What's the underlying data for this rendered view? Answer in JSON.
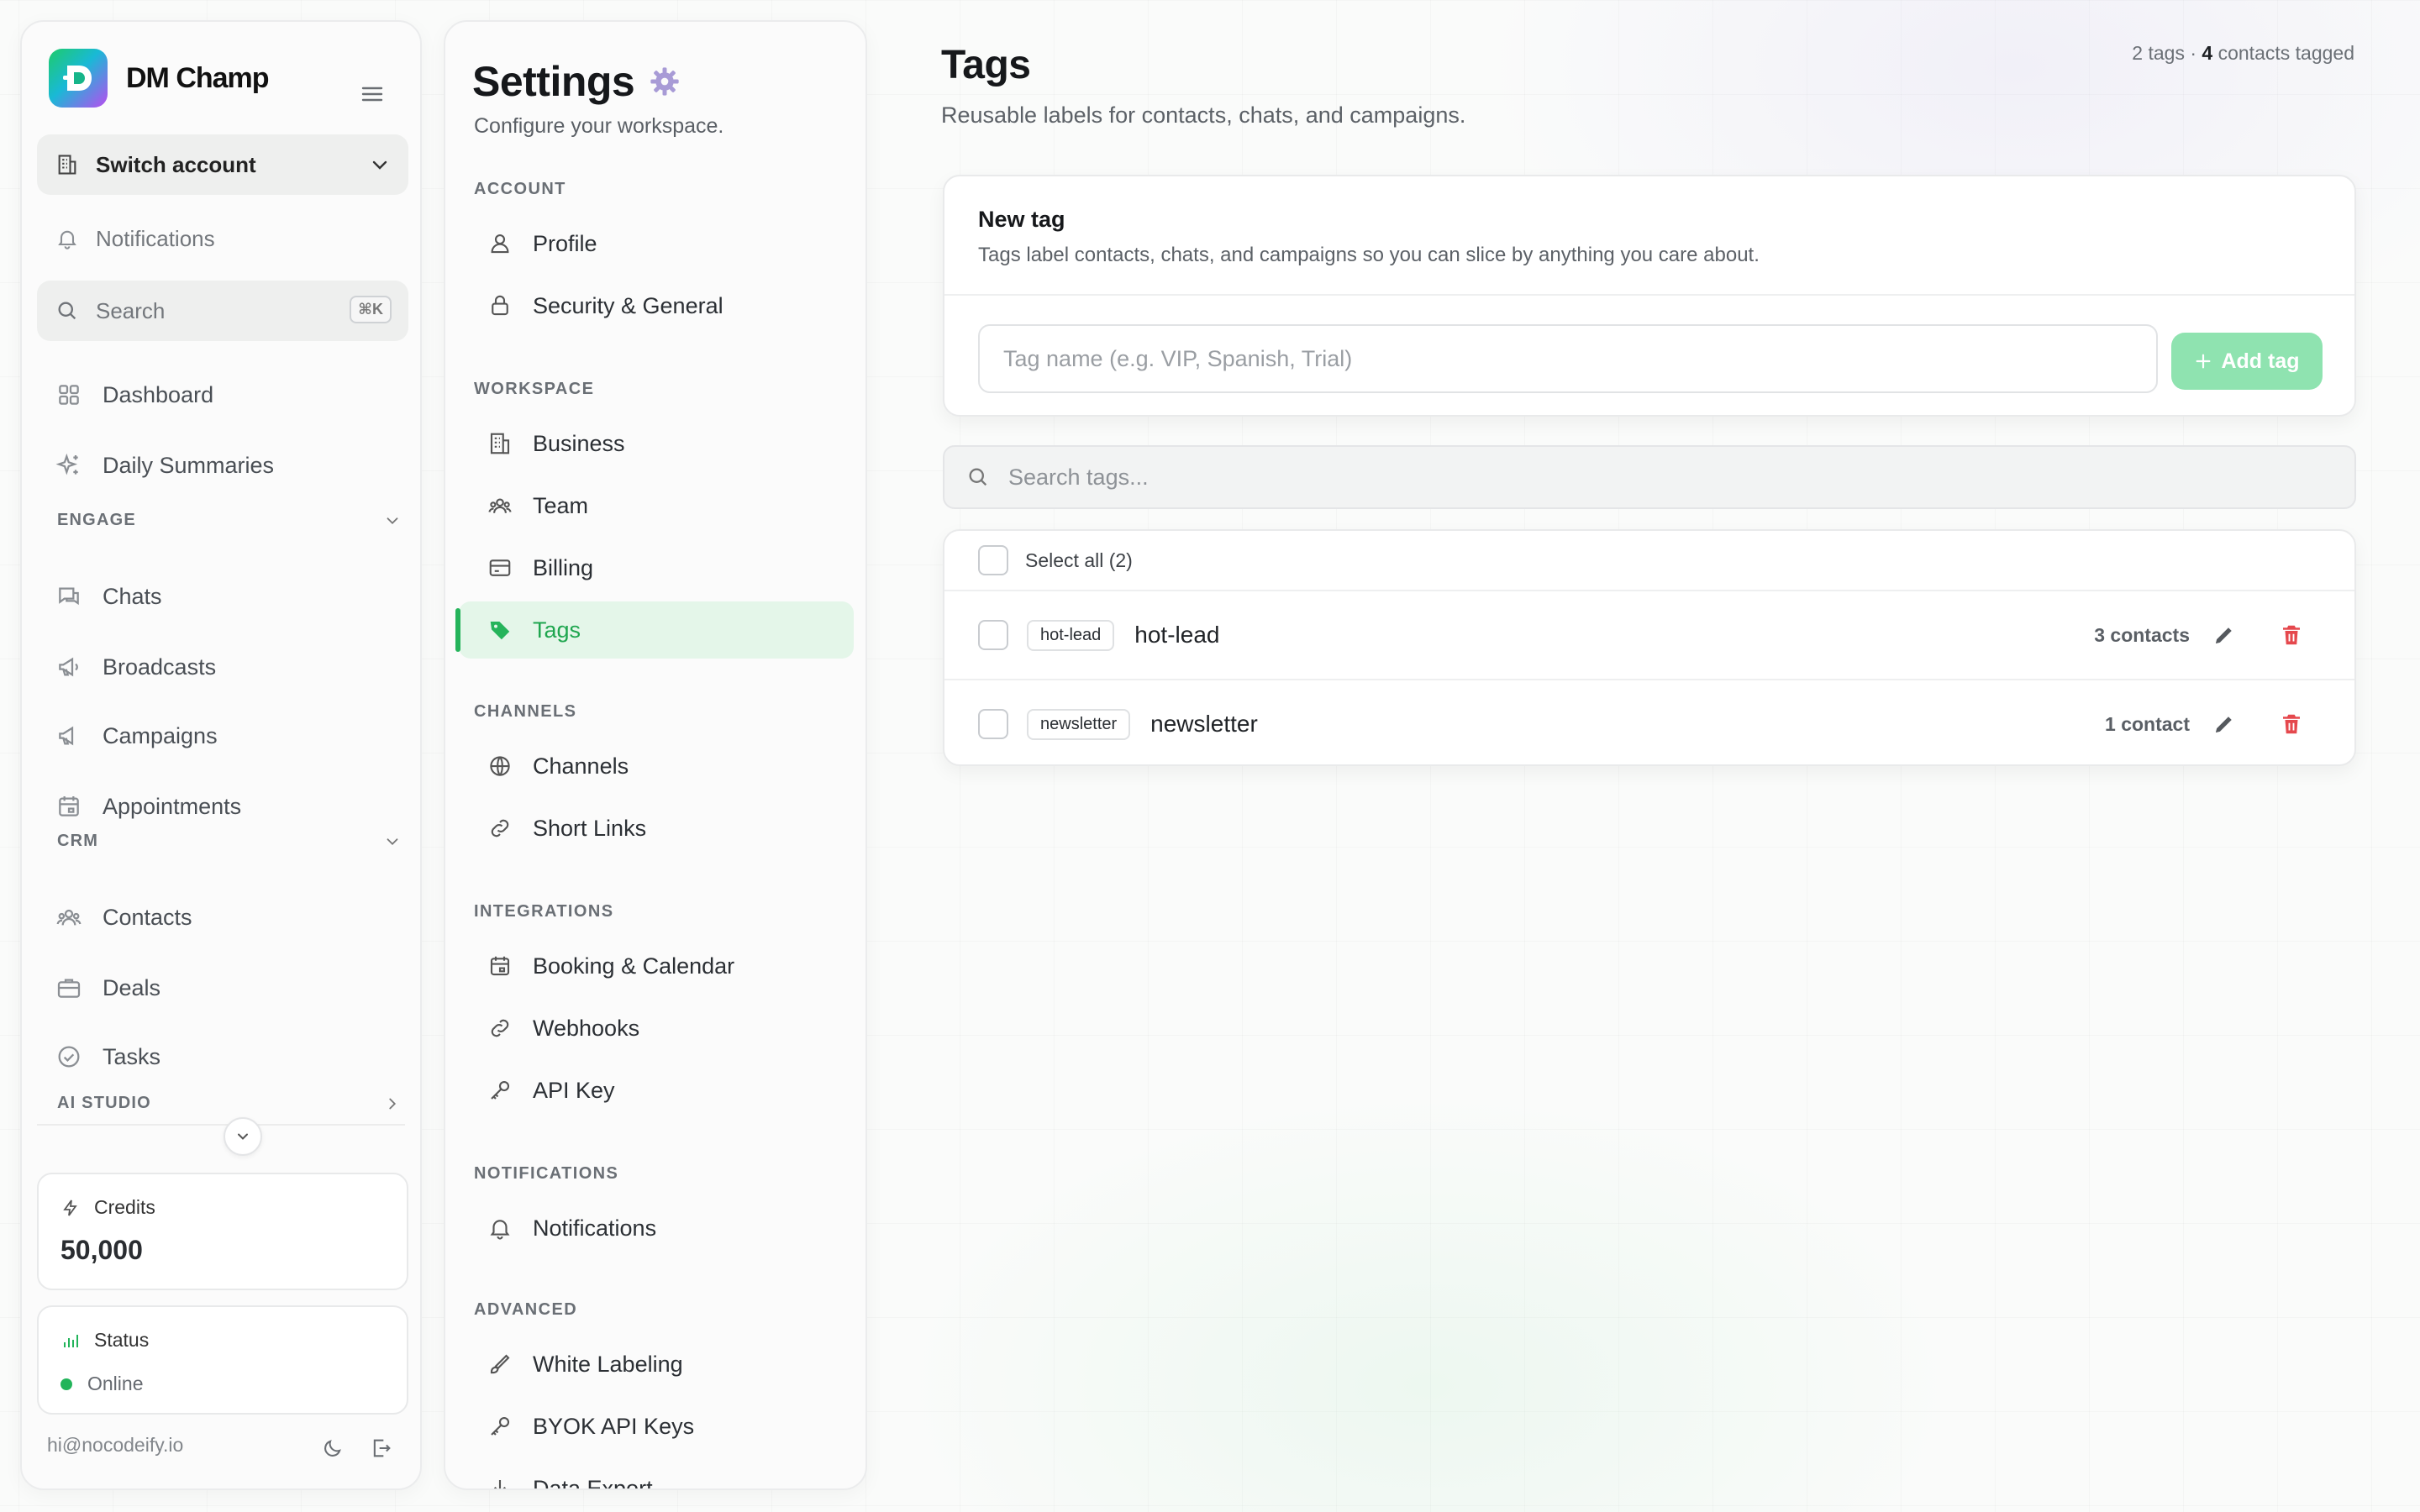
{
  "brand": {
    "name": "DM Champ"
  },
  "sidebar": {
    "switch_account": "Switch account",
    "notifications": "Notifications",
    "search_label": "Search",
    "search_shortcut": "⌘K",
    "items_top": [
      {
        "label": "Dashboard",
        "icon": "grid-icon"
      },
      {
        "label": "Daily Summaries",
        "icon": "sparkles-icon"
      }
    ],
    "engage": {
      "title": "ENGAGE",
      "items": [
        {
          "label": "Chats",
          "icon": "chat-icon"
        },
        {
          "label": "Broadcasts",
          "icon": "megaphone-icon"
        },
        {
          "label": "Campaigns",
          "icon": "megaphone-icon"
        },
        {
          "label": "Appointments",
          "icon": "calendar-icon"
        }
      ]
    },
    "crm": {
      "title": "CRM",
      "items": [
        {
          "label": "Contacts",
          "icon": "users-icon"
        },
        {
          "label": "Deals",
          "icon": "briefcase-icon"
        },
        {
          "label": "Tasks",
          "icon": "check-circle-icon"
        }
      ]
    },
    "ai_studio": {
      "title": "AI STUDIO"
    },
    "credits": {
      "label": "Credits",
      "value": "50,000"
    },
    "status": {
      "label": "Status",
      "value": "Online",
      "color": "#22b45a"
    },
    "footer_email": "hi@nocodeify.io"
  },
  "settings": {
    "title": "Settings",
    "subtitle": "Configure your workspace.",
    "groups": [
      {
        "title": "ACCOUNT",
        "items": [
          "Profile",
          "Security & General"
        ]
      },
      {
        "title": "WORKSPACE",
        "items": [
          "Business",
          "Team",
          "Billing",
          "Tags"
        ]
      },
      {
        "title": "CHANNELS",
        "items": [
          "Channels",
          "Short Links"
        ]
      },
      {
        "title": "INTEGRATIONS",
        "items": [
          "Booking & Calendar",
          "Webhooks",
          "API Key"
        ]
      },
      {
        "title": "NOTIFICATIONS",
        "items": [
          "Notifications"
        ]
      },
      {
        "title": "ADVANCED",
        "items": [
          "White Labeling",
          "BYOK API Keys",
          "Data Export"
        ]
      }
    ],
    "active_item": "Tags",
    "accent_color": "#25b45b"
  },
  "main": {
    "title": "Tags",
    "subtitle": "Reusable labels for contacts, chats, and campaigns.",
    "summary": {
      "tags_text": "2 tags · ",
      "contacts_count": "4",
      "contacts_text": " contacts tagged"
    },
    "new_tag": {
      "title": "New tag",
      "description": "Tags label contacts, chats, and campaigns so you can slice by anything you care about.",
      "input_placeholder": "Tag name (e.g. VIP, Spanish, Trial)",
      "input_value": "",
      "add_button": "Add tag"
    },
    "search_placeholder": "Search tags...",
    "select_all": "Select all (2)",
    "tags": [
      {
        "chip": "hot-lead",
        "name": "hot-lead",
        "count": "3 contacts"
      },
      {
        "chip": "newsletter",
        "name": "newsletter",
        "count": "1 contact"
      }
    ],
    "delete_color": "#e5484d"
  }
}
